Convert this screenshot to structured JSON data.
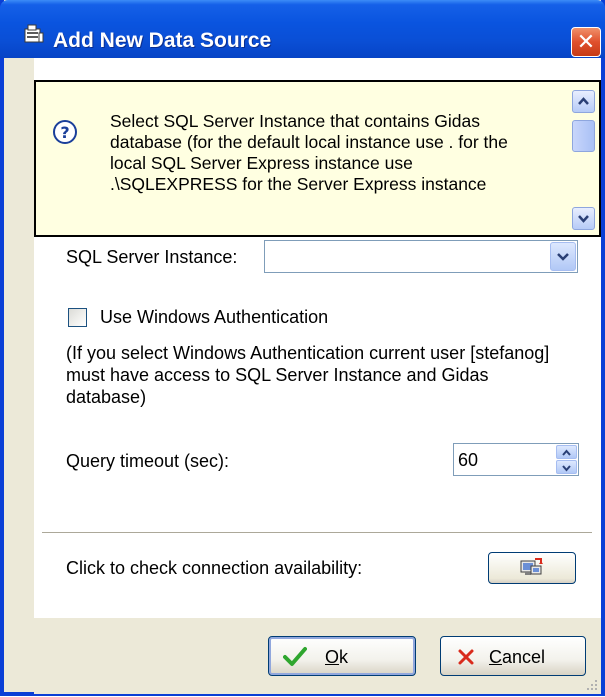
{
  "window": {
    "title": "Add New Data Source",
    "close_glyph": "✕"
  },
  "info": {
    "text": "Select SQL Server Instance that contains Gidas\ndatabase (for the default local instance use . for the\nlocal SQL Server Express instance use\n.\\SQLEXPRESS for the Server Express instance",
    "icon": "question-icon"
  },
  "form": {
    "instance_label": "SQL Server Instance:",
    "instance_value": "",
    "windows_auth_label": "Use Windows Authentication",
    "windows_auth_checked": false,
    "windows_auth_note": "(If you select Windows Authentication current user [stefanog]\nmust have access to SQL Server Instance and Gidas\ndatabase)",
    "timeout_label": "Query timeout (sec):",
    "timeout_value": "60",
    "check_label": "Click to check connection availability:"
  },
  "buttons": {
    "ok_label": "Ok",
    "ok_mnemonic": "O",
    "cancel_label": "Cancel",
    "cancel_mnemonic": "C"
  },
  "colors": {
    "title_bar": "#0a54df",
    "info_background": "#ffffe1",
    "ok_check": "#2fa62f",
    "cancel_x": "#d92b1c"
  }
}
